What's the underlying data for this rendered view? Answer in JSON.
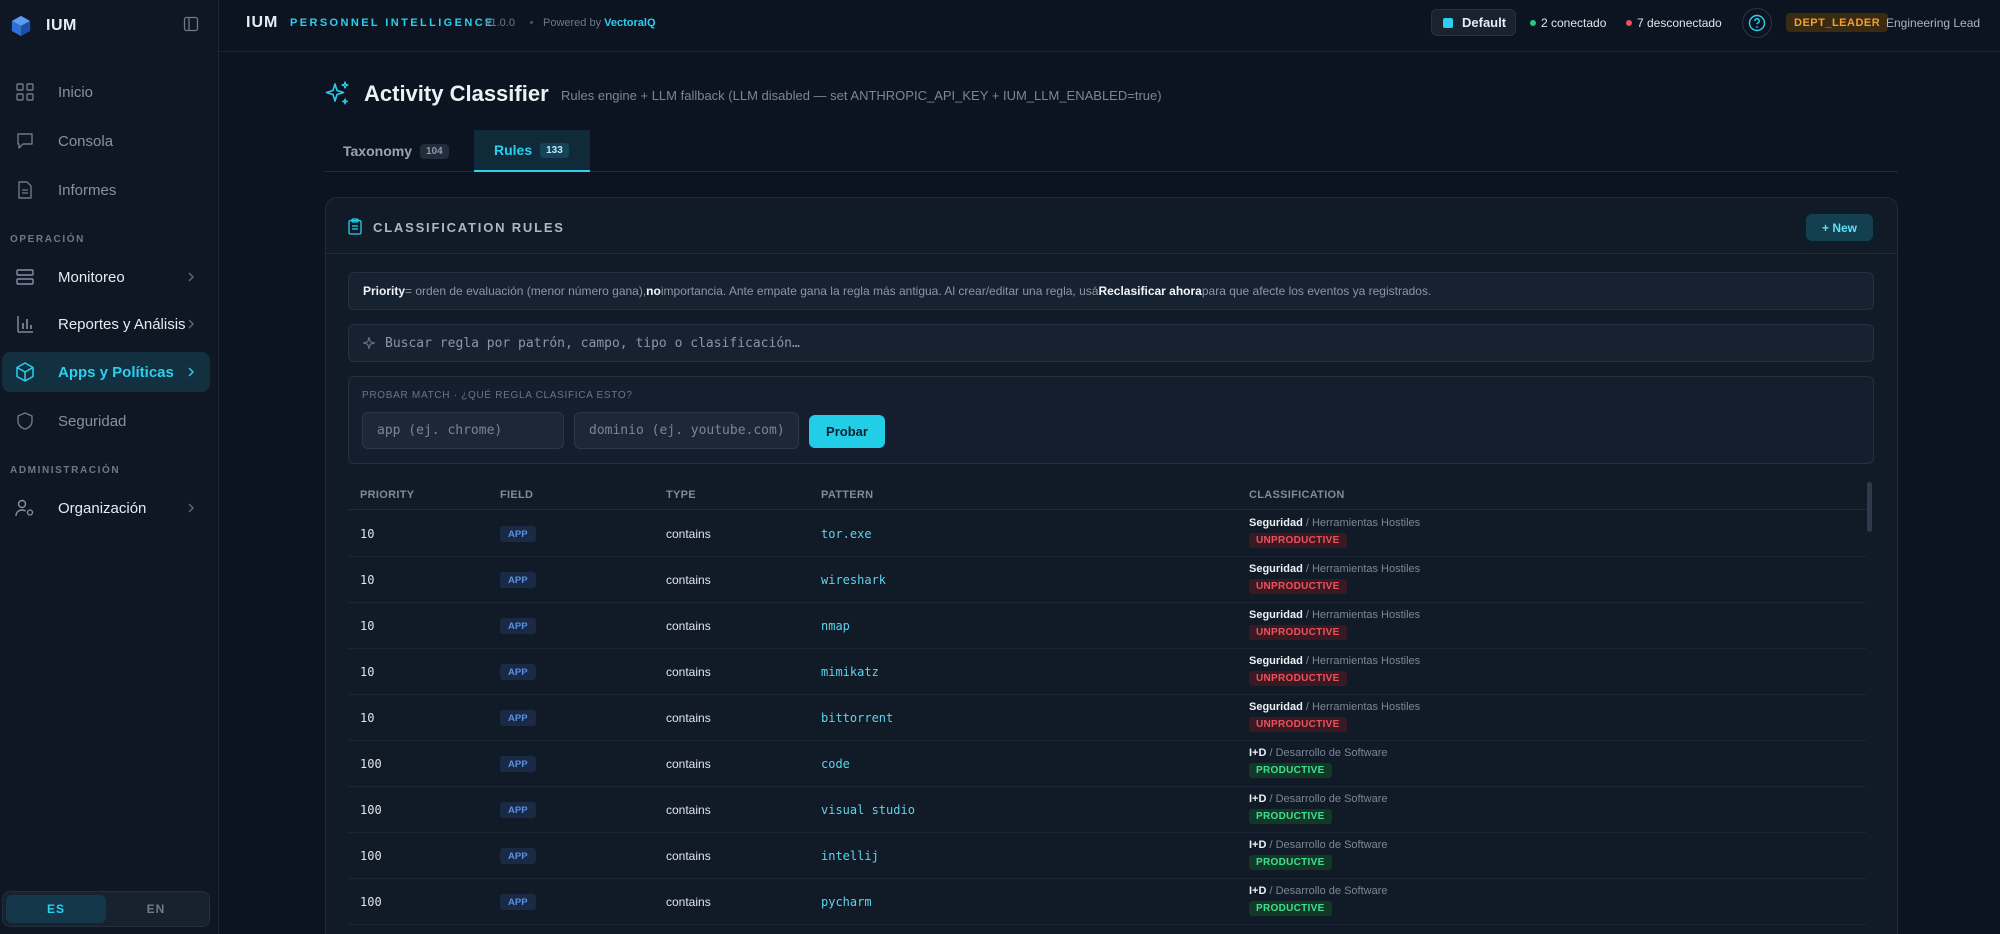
{
  "sidebar": {
    "brand": "IUM",
    "items": [
      {
        "label": "Inicio"
      },
      {
        "label": "Consola"
      },
      {
        "label": "Informes"
      }
    ],
    "section_operacion": "OPERACIÓN",
    "ops_items": [
      {
        "label": "Monitoreo"
      },
      {
        "label": "Reportes y Análisis"
      },
      {
        "label": "Apps y Políticas"
      },
      {
        "label": "Seguridad"
      }
    ],
    "section_admin": "ADMINISTRACIÓN",
    "admin_items": [
      {
        "label": "Organización"
      }
    ],
    "lang": {
      "es": "ES",
      "en": "EN"
    }
  },
  "topbar": {
    "title": "IUM",
    "subtitle": "PERSONNEL INTELLIGENCE",
    "version": "v1.0.0",
    "powered_prefix": "Powered by ",
    "powered_brand": "VectoralQ",
    "workspace": "Default",
    "connected": "2 conectado",
    "disconnected": "7 desconectado",
    "role": "DEPT_LEADER",
    "role_name": "Engineering Lead"
  },
  "colors": {
    "accent": "#2ad0ee",
    "connected": "#28c48a",
    "disconnected": "#f0505e",
    "role": "#f0a030"
  },
  "header": {
    "title": "Activity Classifier",
    "description": "Rules engine + LLM fallback (LLM disabled — set ANTHROPIC_API_KEY + IUM_LLM_ENABLED=true)"
  },
  "tabs": [
    {
      "label": "Taxonomy",
      "count": "104"
    },
    {
      "label": "Rules",
      "count": "133"
    }
  ],
  "card": {
    "title": "CLASSIFICATION RULES",
    "new_button": "+ New",
    "note": {
      "p1": "Priority",
      "p2": " = orden de evaluación (menor número gana), ",
      "p3": "no",
      "p4": " importancia. Ante empate gana la regla más antigua. Al crear/editar una regla, usá ",
      "p5": "Reclasificar ahora",
      "p6": " para que afecte los eventos ya registrados."
    },
    "search_placeholder": "Buscar regla por patrón, campo, tipo o clasificación…",
    "probe": {
      "title": "PROBAR MATCH · ¿QUÉ REGLA CLASIFICA ESTO?",
      "app_placeholder": "app (ej. chrome)",
      "domain_placeholder": "dominio (ej. youtube.com)",
      "button": "Probar"
    }
  },
  "table": {
    "headers": [
      "PRIORITY",
      "FIELD",
      "TYPE",
      "PATTERN",
      "CLASSIFICATION"
    ],
    "rows": [
      {
        "priority": "10",
        "field": "APP",
        "type": "contains",
        "pattern": "tor.exe",
        "category": "Seguridad",
        "sub": " / Herramientas Hostiles",
        "badge": "UNPRODUCTIVE"
      },
      {
        "priority": "10",
        "field": "APP",
        "type": "contains",
        "pattern": "wireshark",
        "category": "Seguridad",
        "sub": " / Herramientas Hostiles",
        "badge": "UNPRODUCTIVE"
      },
      {
        "priority": "10",
        "field": "APP",
        "type": "contains",
        "pattern": "nmap",
        "category": "Seguridad",
        "sub": " / Herramientas Hostiles",
        "badge": "UNPRODUCTIVE"
      },
      {
        "priority": "10",
        "field": "APP",
        "type": "contains",
        "pattern": "mimikatz",
        "category": "Seguridad",
        "sub": " / Herramientas Hostiles",
        "badge": "UNPRODUCTIVE"
      },
      {
        "priority": "10",
        "field": "APP",
        "type": "contains",
        "pattern": "bittorrent",
        "category": "Seguridad",
        "sub": " / Herramientas Hostiles",
        "badge": "UNPRODUCTIVE"
      },
      {
        "priority": "100",
        "field": "APP",
        "type": "contains",
        "pattern": "code",
        "category": "I+D",
        "sub": " / Desarrollo de Software",
        "badge": "PRODUCTIVE"
      },
      {
        "priority": "100",
        "field": "APP",
        "type": "contains",
        "pattern": "visual studio",
        "category": "I+D",
        "sub": " / Desarrollo de Software",
        "badge": "PRODUCTIVE"
      },
      {
        "priority": "100",
        "field": "APP",
        "type": "contains",
        "pattern": "intellij",
        "category": "I+D",
        "sub": " / Desarrollo de Software",
        "badge": "PRODUCTIVE"
      },
      {
        "priority": "100",
        "field": "APP",
        "type": "contains",
        "pattern": "pycharm",
        "category": "I+D",
        "sub": " / Desarrollo de Software",
        "badge": "PRODUCTIVE"
      }
    ]
  }
}
